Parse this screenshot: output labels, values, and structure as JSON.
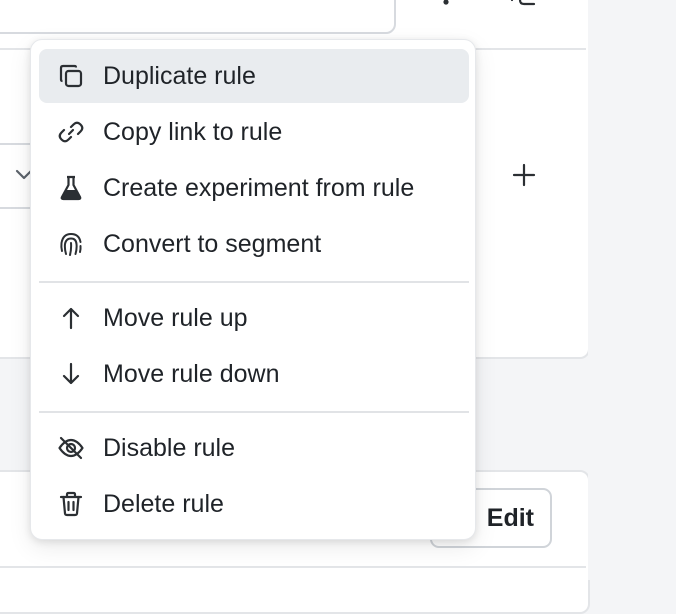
{
  "background": {
    "edit_button_label": "Edit",
    "icons": [
      "kebab-icon",
      "sidebar-toggle-icon",
      "chevron-down-icon",
      "plus-icon"
    ]
  },
  "context_menu": {
    "groups": [
      [
        {
          "label": "Duplicate rule",
          "icon": "duplicate-icon",
          "active": true
        },
        {
          "label": "Copy link to rule",
          "icon": "link-icon"
        },
        {
          "label": "Create experiment from rule",
          "icon": "flask-icon"
        },
        {
          "label": "Convert to segment",
          "icon": "fingerprint-icon"
        }
      ],
      [
        {
          "label": "Move rule up",
          "icon": "arrow-up-icon"
        },
        {
          "label": "Move rule down",
          "icon": "arrow-down-icon"
        }
      ],
      [
        {
          "label": "Disable rule",
          "icon": "eye-off-icon"
        },
        {
          "label": "Delete rule",
          "icon": "trash-icon"
        }
      ]
    ]
  },
  "colors": {
    "highlight": "#e9ecef",
    "text": "#1f2328",
    "icon": "#2b2f33"
  }
}
